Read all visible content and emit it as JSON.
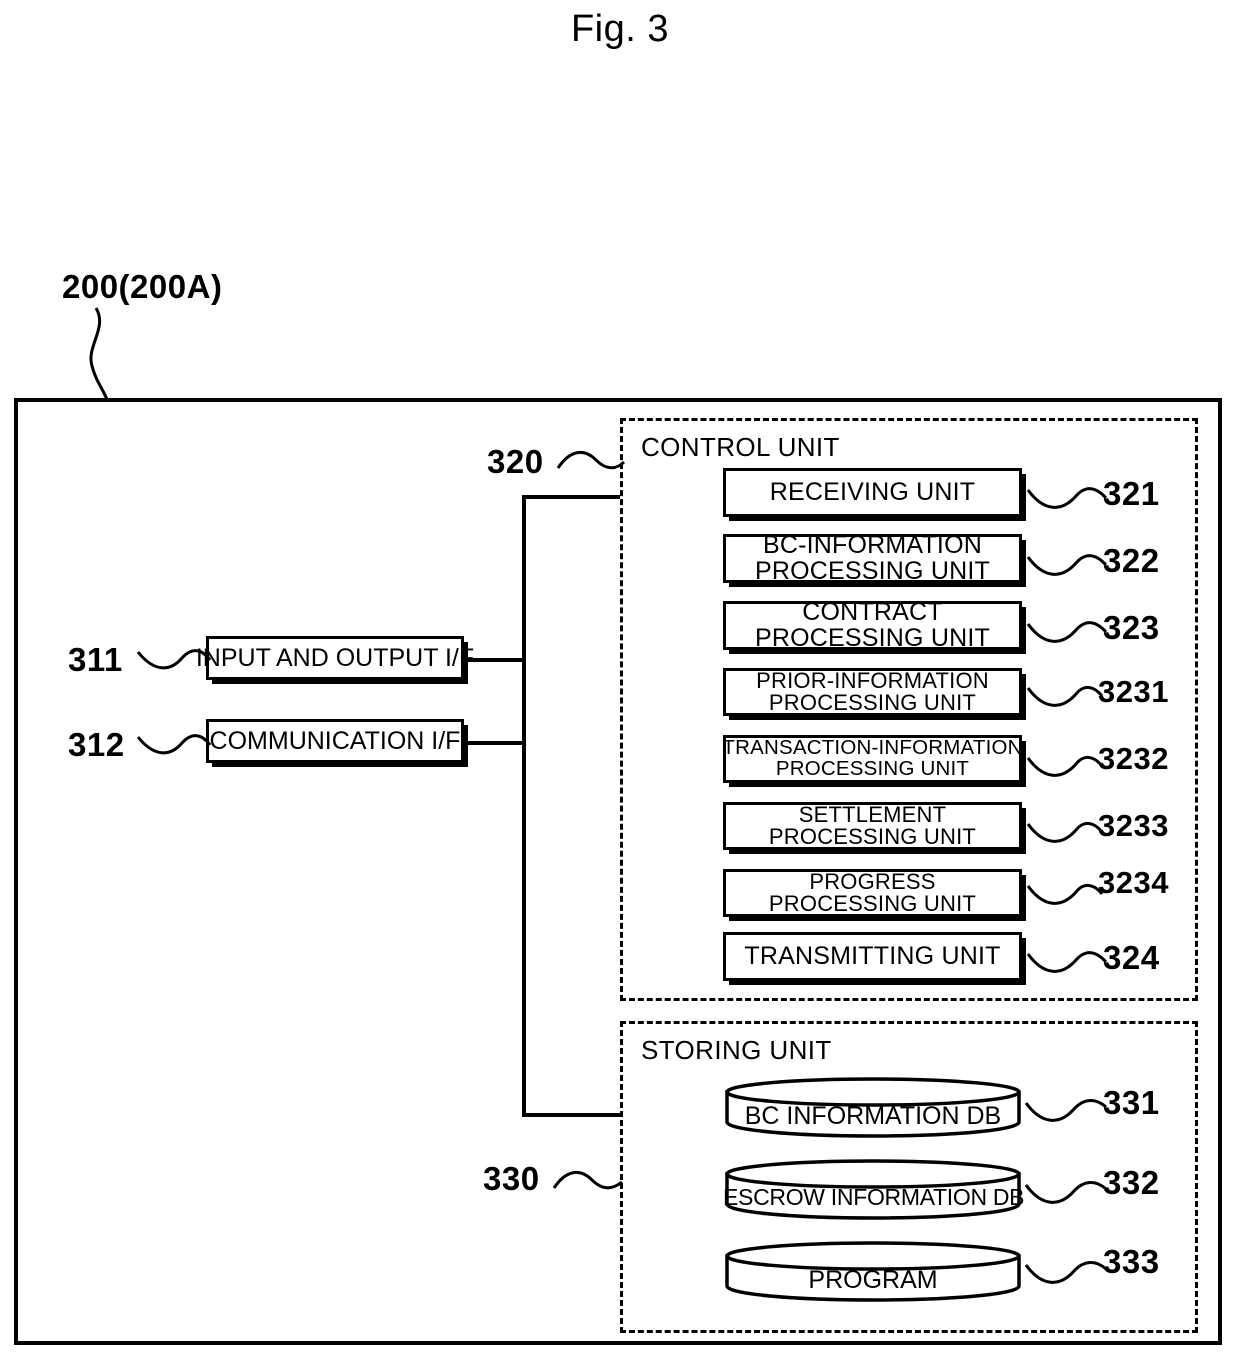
{
  "figure": {
    "title": "Fig. 3",
    "device_reference": "200(200A)"
  },
  "interfaces": [
    {
      "ref": "311",
      "label": "INPUT AND OUTPUT I/F"
    },
    {
      "ref": "312",
      "label": "COMMUNICATION I/F"
    }
  ],
  "control_unit": {
    "ref": "320",
    "title": "CONTROL UNIT",
    "units": [
      {
        "ref": "321",
        "line1": "RECEIVING UNIT",
        "line2": ""
      },
      {
        "ref": "322",
        "line1": "BC-INFORMATION",
        "line2": "PROCESSING UNIT"
      },
      {
        "ref": "323",
        "line1": "CONTRACT",
        "line2": "PROCESSING UNIT"
      },
      {
        "ref": "3231",
        "line1": "PRIOR-INFORMATION",
        "line2": "PROCESSING UNIT"
      },
      {
        "ref": "3232",
        "line1": "TRANSACTION-INFORMATION",
        "line2": "PROCESSING UNIT"
      },
      {
        "ref": "3233",
        "line1": "SETTLEMENT",
        "line2": "PROCESSING UNIT"
      },
      {
        "ref": "3234",
        "line1": "PROGRESS",
        "line2": "PROCESSING UNIT"
      },
      {
        "ref": "324",
        "line1": "TRANSMITTING UNIT",
        "line2": ""
      }
    ]
  },
  "storing_unit": {
    "ref": "330",
    "title": "STORING UNIT",
    "stores": [
      {
        "ref": "331",
        "label": "BC INFORMATION DB"
      },
      {
        "ref": "332",
        "label": "ESCROW INFORMATION DB"
      },
      {
        "ref": "333",
        "label": "PROGRAM"
      }
    ]
  },
  "colors": {
    "line": "#000000",
    "background": "#ffffff"
  }
}
